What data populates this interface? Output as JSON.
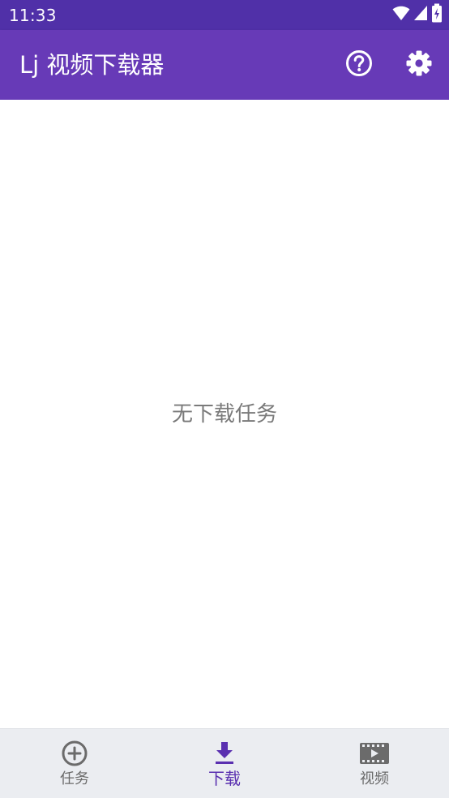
{
  "status_bar": {
    "time": "11:33",
    "icons": [
      "wifi-icon",
      "signal-icon",
      "battery-charging-icon"
    ]
  },
  "app_bar": {
    "title": "Lj 视频下载器",
    "actions": [
      "help-icon",
      "settings-icon"
    ]
  },
  "main": {
    "empty_message": "无下载任务"
  },
  "bottom_nav": {
    "items": [
      {
        "label": "任务",
        "icon": "add-circle-icon",
        "active": false
      },
      {
        "label": "下载",
        "icon": "download-icon",
        "active": true
      },
      {
        "label": "视频",
        "icon": "video-film-icon",
        "active": false
      }
    ]
  },
  "colors": {
    "status_bar": "#5030a8",
    "app_bar": "#673ab7",
    "active_nav": "#5a30b0",
    "inactive_nav": "#6b6b6b",
    "bottom_nav_bg": "#ebedf1",
    "empty_text": "#7a7a7a"
  }
}
